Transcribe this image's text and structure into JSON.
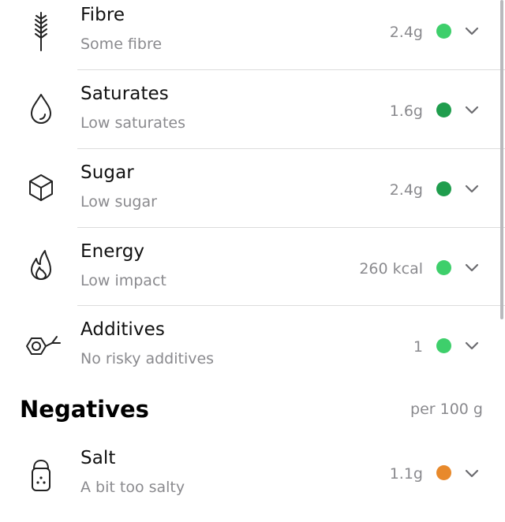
{
  "positives": [
    {
      "id": "fibre",
      "icon": "wheat-icon",
      "title": "Fibre",
      "subtitle": "Some fibre",
      "value": "2.4g",
      "color": "#3ecf6b"
    },
    {
      "id": "saturates",
      "icon": "droplet-icon",
      "title": "Saturates",
      "subtitle": "Low saturates",
      "value": "1.6g",
      "color": "#1f9d4d"
    },
    {
      "id": "sugar",
      "icon": "sugar-cube-icon",
      "title": "Sugar",
      "subtitle": "Low sugar",
      "value": "2.4g",
      "color": "#1f9d4d"
    },
    {
      "id": "energy",
      "icon": "flame-icon",
      "title": "Energy",
      "subtitle": "Low impact",
      "value": "260 kcal",
      "color": "#3ecf6b"
    },
    {
      "id": "additives",
      "icon": "molecule-icon",
      "title": "Additives",
      "subtitle": "No risky additives",
      "value": "1",
      "color": "#3ecf6b"
    }
  ],
  "negatives_section": {
    "title": "Negatives",
    "unit": "per 100 g"
  },
  "negatives": [
    {
      "id": "salt",
      "icon": "salt-shaker-icon",
      "title": "Salt",
      "subtitle": "A bit too salty",
      "value": "1.1g",
      "color": "#e8892b"
    }
  ]
}
